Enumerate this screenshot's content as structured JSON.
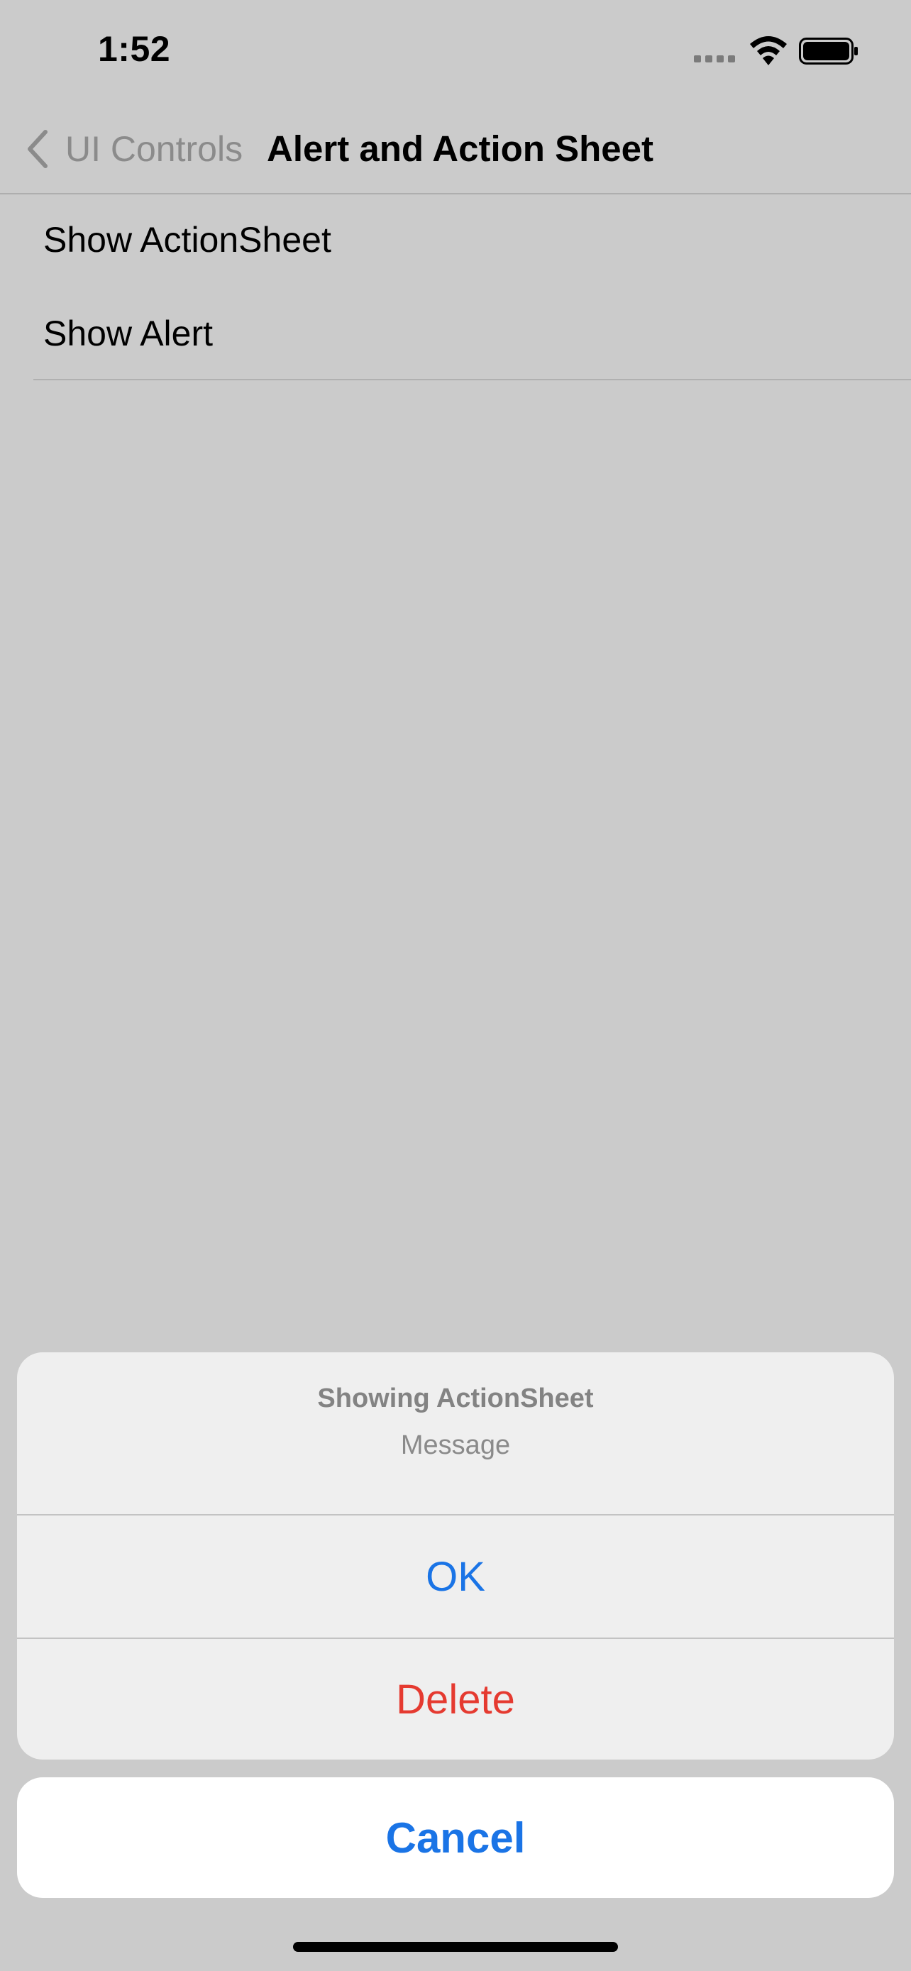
{
  "status_bar": {
    "time": "1:52",
    "icons": [
      "cellular-signal-icon",
      "wifi-icon",
      "battery-icon"
    ]
  },
  "nav": {
    "back_label": "UI Controls",
    "title": "Alert and Action Sheet"
  },
  "list": {
    "items": [
      {
        "label": "Show ActionSheet"
      },
      {
        "label": "Show Alert"
      }
    ]
  },
  "action_sheet": {
    "title": "Showing ActionSheet",
    "message": "Message",
    "actions": [
      {
        "label": "OK",
        "style": "default"
      },
      {
        "label": "Delete",
        "style": "destructive"
      }
    ],
    "cancel_label": "Cancel"
  },
  "colors": {
    "dimmed_background": "#cbcbcb",
    "sheet_background": "#efefef",
    "accent_blue": "#1a74e6",
    "destructive_red": "#e53a30"
  }
}
